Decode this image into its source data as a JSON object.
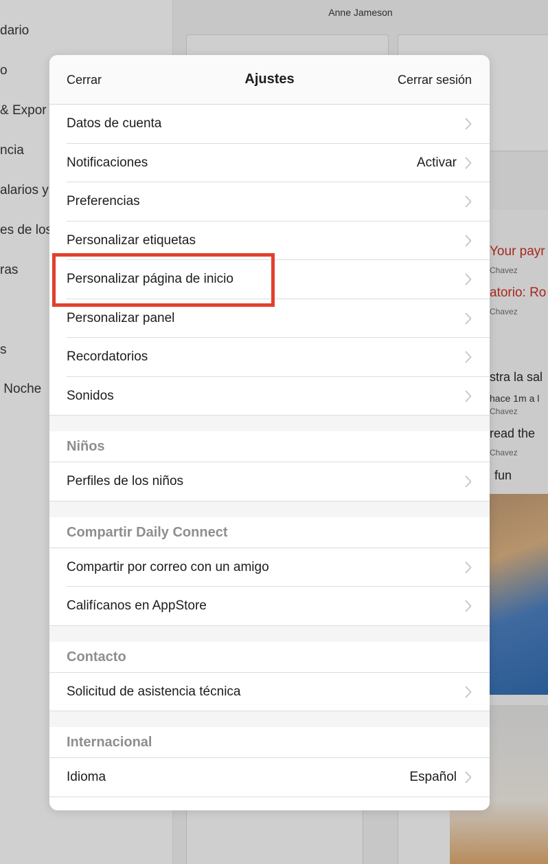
{
  "background": {
    "user_name": "Anne Jameson",
    "sidebar_items": [
      "dario",
      "o",
      "& Expor",
      "ncia",
      "alarios y",
      "es de los",
      "ras",
      "s",
      " Noche"
    ],
    "feed": {
      "payment": "Your payr",
      "payment_by": "Chavez",
      "reminder": "atorio: Ro",
      "reminder_by": "Chavez",
      "post1": "stra la sal",
      "post1_meta": "hace 1m a l",
      "post1_by": "Chavez",
      "post2": "read the",
      "post2_by": "Chavez",
      "post3": "fun"
    }
  },
  "header": {
    "close_label": "Cerrar",
    "title": "Ajustes",
    "logout_label": "Cerrar sesión"
  },
  "rows_main": [
    {
      "label": "Datos de cuenta",
      "value": ""
    },
    {
      "label": "Notificaciones",
      "value": "Activar"
    },
    {
      "label": "Preferencias",
      "value": ""
    },
    {
      "label": "Personalizar etiquetas",
      "value": ""
    },
    {
      "label": "Personalizar página de inicio",
      "value": ""
    },
    {
      "label": "Personalizar panel",
      "value": ""
    },
    {
      "label": "Recordatorios",
      "value": ""
    },
    {
      "label": "Sonidos",
      "value": ""
    }
  ],
  "sections": [
    {
      "title": "Niños",
      "rows": [
        {
          "label": "Perfiles de los niños",
          "value": ""
        }
      ]
    },
    {
      "title": "Compartir Daily Connect",
      "rows": [
        {
          "label": "Compartir por correo con un amigo",
          "value": ""
        },
        {
          "label": "Califícanos en AppStore",
          "value": ""
        }
      ]
    },
    {
      "title": "Contacto",
      "rows": [
        {
          "label": "Solicitud de asistencia técnica",
          "value": ""
        }
      ]
    },
    {
      "title": "Internacional",
      "rows": [
        {
          "label": "Idioma",
          "value": "Español"
        }
      ]
    }
  ],
  "colors": {
    "highlight": "#e1402c",
    "section_title": "#8e8e8e",
    "chevron": "#c4c4c9"
  },
  "icons": {
    "row_chevron": "chevron-right-icon"
  }
}
